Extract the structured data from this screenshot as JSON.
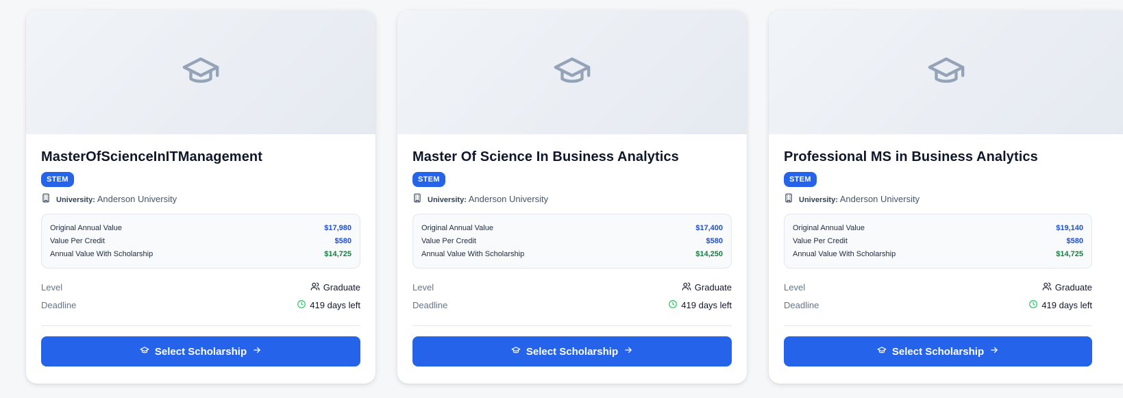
{
  "cards": [
    {
      "title": "MasterOfScienceInITManagement",
      "badge": "STEM",
      "university_label": "University:",
      "university": "Anderson University",
      "values": [
        {
          "label": "Original Annual Value",
          "value": "$17,980"
        },
        {
          "label": "Value Per Credit",
          "value": "$580"
        },
        {
          "label": "Annual Value With Scholarship",
          "value": "$14,725"
        }
      ],
      "level_label": "Level",
      "level": "Graduate",
      "deadline_label": "Deadline",
      "deadline": "419 days left",
      "button": "Select Scholarship"
    },
    {
      "title": "Master Of Science In Business Analytics",
      "badge": "STEM",
      "university_label": "University:",
      "university": "Anderson University",
      "values": [
        {
          "label": "Original Annual Value",
          "value": "$17,400"
        },
        {
          "label": "Value Per Credit",
          "value": "$580"
        },
        {
          "label": "Annual Value With Scholarship",
          "value": "$14,250"
        }
      ],
      "level_label": "Level",
      "level": "Graduate",
      "deadline_label": "Deadline",
      "deadline": "419 days left",
      "button": "Select Scholarship"
    },
    {
      "title": "Professional MS in Business Analytics",
      "badge": "STEM",
      "university_label": "University:",
      "university": "Anderson University",
      "values": [
        {
          "label": "Original Annual Value",
          "value": "$19,140"
        },
        {
          "label": "Value Per Credit",
          "value": "$580"
        },
        {
          "label": "Annual Value With Scholarship",
          "value": "$14,725"
        }
      ],
      "level_label": "Level",
      "level": "Graduate",
      "deadline_label": "Deadline",
      "deadline": "419 days left",
      "button": "Select Scholarship"
    }
  ],
  "icons": {
    "hero": "graduation-cap-icon",
    "university": "building-icon",
    "level": "users-icon",
    "deadline": "clock-icon",
    "button_leading": "graduation-cap-icon",
    "button_trailing": "arrow-right-icon"
  },
  "colors": {
    "primary": "#2563eb",
    "value_blue": "#1d4ed8",
    "value_green": "#15803d",
    "clock_green": "#22c55e",
    "hero_icon": "#94a3b8"
  }
}
